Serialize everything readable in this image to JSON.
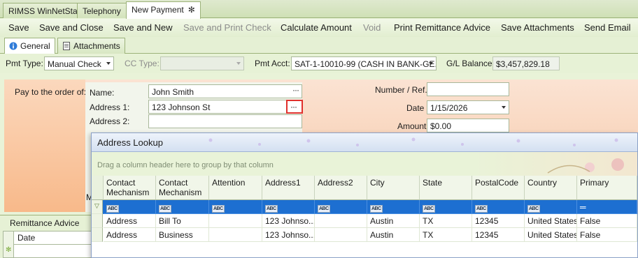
{
  "doc_tabs": [
    {
      "label": "RIMSS WinNetStar"
    },
    {
      "label": "Telephony"
    },
    {
      "label": "New Payment",
      "active": true
    }
  ],
  "toolbar": {
    "save": "Save",
    "save_close": "Save and Close",
    "save_new": "Save and New",
    "save_print_check": "Save and Print Check",
    "calculate_amount": "Calculate Amount",
    "void": "Void",
    "print_remittance": "Print Remittance Advice",
    "save_attachments": "Save Attachments",
    "send_email": "Send Email"
  },
  "form_tabs": {
    "general": "General",
    "attachments": "Attachments"
  },
  "pmt_bar": {
    "pmt_type_label": "Pmt Type:",
    "pmt_type_value": "Manual Check",
    "cc_type_label": "CC Type:",
    "cc_type_value": "",
    "pmt_acct_label": "Pmt Acct:",
    "pmt_acct_value": "SAT-1-10010-99 (CASH IN BANK-GE...",
    "gl_balance_label": "G/L Balance:",
    "gl_balance_value": "$3,457,829.18"
  },
  "payee": {
    "pay_to_label": "Pay to the order of:",
    "name_label": "Name:",
    "name_value": "John Smith",
    "address1_label": "Address 1:",
    "address1_value": "123 Johnson St",
    "address2_label": "Address 2:",
    "address2_value": "",
    "m_label": "M"
  },
  "right_fields": {
    "number_ref_label": "Number / Ref.",
    "number_ref_value": "",
    "date_label": "Date",
    "date_value": "1/15/2026",
    "amount_label": "Amount",
    "amount_value": "$0.00"
  },
  "remittance": {
    "title": "Remittance Advice",
    "date_col": "Date"
  },
  "lookup": {
    "title": "Address Lookup",
    "group_hint": "Drag a column header here to group by that column",
    "columns": [
      "Contact Mechanism ...",
      "Contact Mechanism ...",
      "Attention",
      "Address1",
      "Address2",
      "City",
      "State",
      "PostalCode",
      "Country",
      "Primary"
    ],
    "filter_abc": "ABC",
    "filter_primary": "═",
    "rows": [
      [
        "Address",
        "Bill To",
        "",
        "123 Johnso...",
        "",
        "Austin",
        "TX",
        "12345",
        "United States",
        "False"
      ],
      [
        "Address",
        "Business",
        "",
        "123 Johnso...",
        "",
        "Austin",
        "TX",
        "12345",
        "United States",
        "False"
      ]
    ]
  },
  "colors": {
    "accent_green": "#9cb27a",
    "selected_blue": "#1d6fd1",
    "highlight_red": "#e0302c"
  }
}
